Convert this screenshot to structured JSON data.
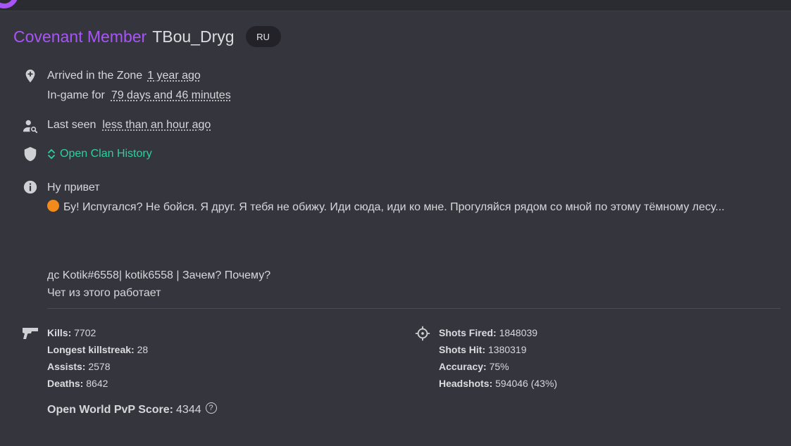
{
  "profile": {
    "rank": "Covenant Member",
    "username": "TBou_Dryg",
    "language": "RU"
  },
  "info": {
    "arrived_label": "Arrived in the Zone",
    "arrived_value": "1 year ago",
    "ingame_label": "In-game for",
    "ingame_value": "79 days and 46 minutes",
    "lastseen_label": "Last seen",
    "lastseen_value": "less than an hour ago",
    "clan_history_label": "Open Clan History"
  },
  "bio": {
    "line1": "Ну привет",
    "line2": "Бу! Испугался? Не бойся. Я друг. Я тебя не обижу. Иди сюда, иди ко мне. Прогуляйся рядом со мной по этому тёмному лесу...",
    "line3": "дс Kotik#6558| kotik6558 | Зачем? Почему?",
    "line4": "Чет из этого работает"
  },
  "stats_left": [
    {
      "label": "Kills:",
      "value": "7702"
    },
    {
      "label": "Longest killstreak:",
      "value": "28"
    },
    {
      "label": "Assists:",
      "value": "2578"
    },
    {
      "label": "Deaths:",
      "value": "8642"
    }
  ],
  "stats_right": [
    {
      "label": "Shots Fired:",
      "value": "1848039"
    },
    {
      "label": "Shots Hit:",
      "value": "1380319"
    },
    {
      "label": "Accuracy:",
      "value": "75%"
    },
    {
      "label": "Headshots:",
      "value": "594046 (43%)"
    }
  ],
  "score": {
    "label": "Open World PvP Score:",
    "value": "4344",
    "help_glyph": "?"
  },
  "icons": {
    "location": "map-pin-icon",
    "lastseen": "user-search-icon",
    "clan": "shield-icon",
    "clan_toggle": "chevron-up-down-icon",
    "bio": "info-icon",
    "combat": "gun-icon",
    "shooting": "crosshair-icon",
    "help": "help-circle-icon"
  },
  "colors": {
    "background": "#35353d",
    "accent_purple": "#a855f7",
    "link_green": "#2bd1a1",
    "badge_bg": "#222228"
  }
}
